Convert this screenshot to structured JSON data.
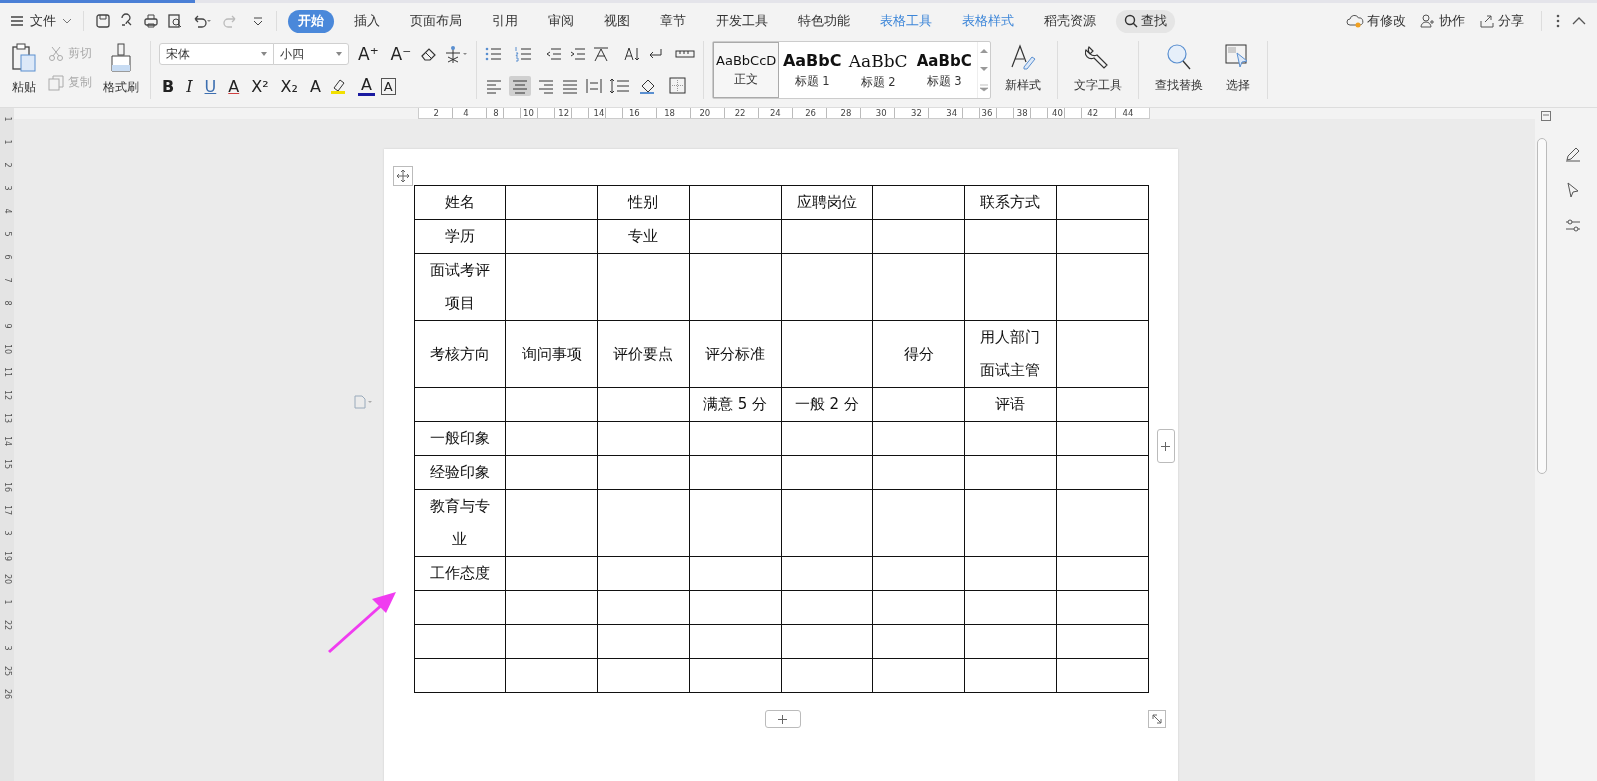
{
  "menu": {
    "file": "文件",
    "tabs": [
      {
        "label": "开始",
        "selected": true,
        "kind": "main"
      },
      {
        "label": "插入",
        "selected": false,
        "kind": "main"
      },
      {
        "label": "页面布局",
        "selected": false,
        "kind": "main"
      },
      {
        "label": "引用",
        "selected": false,
        "kind": "main"
      },
      {
        "label": "审阅",
        "selected": false,
        "kind": "main"
      },
      {
        "label": "视图",
        "selected": false,
        "kind": "main"
      },
      {
        "label": "章节",
        "selected": false,
        "kind": "main"
      },
      {
        "label": "开发工具",
        "selected": false,
        "kind": "main"
      },
      {
        "label": "特色功能",
        "selected": false,
        "kind": "main"
      },
      {
        "label": "表格工具",
        "selected": false,
        "kind": "context"
      },
      {
        "label": "表格样式",
        "selected": false,
        "kind": "context"
      },
      {
        "label": "稻壳资源",
        "selected": false,
        "kind": "main"
      }
    ],
    "search": "查找",
    "right": [
      "有修改",
      "协作",
      "分享"
    ]
  },
  "ribbon": {
    "paste": "粘贴",
    "cut": {
      "label": "剪切",
      "disabled": true
    },
    "copy": {
      "label": "复制",
      "disabled": true
    },
    "format_painter": "格式刷",
    "font_name": "宋体",
    "font_size": "小四",
    "size_buttons": [
      "A⁺",
      "A⁻"
    ],
    "format_buttons": [
      "B",
      "I",
      "U",
      "A",
      "X²",
      "X₂",
      "A"
    ],
    "font_color": "A",
    "char_border": "A",
    "styles": [
      {
        "preview": "AaBbCcD",
        "label": "正文",
        "selected": true,
        "kind": "body"
      },
      {
        "preview": "AaBbC",
        "label": "标题 1",
        "selected": false,
        "kind": "h1"
      },
      {
        "preview": "AaBbC",
        "label": "标题 2",
        "selected": false,
        "kind": "h2"
      },
      {
        "preview": "AaBbC",
        "label": "标题 3",
        "selected": false,
        "kind": "h3"
      }
    ],
    "new_style": "新样式",
    "text_tools": "文字工具",
    "find_replace": "查找替换",
    "select": "选择"
  },
  "ruler": {
    "h_ticks": [
      "2",
      "4",
      "8",
      "10",
      "12",
      "14",
      "16",
      "18",
      "20",
      "22",
      "24",
      "26",
      "28",
      "30",
      "32",
      "34",
      "36",
      "38",
      "40",
      "42",
      "44"
    ],
    "v_ticks": [
      "1",
      "1",
      "2",
      "3",
      "4",
      "5",
      "6",
      "7",
      "8",
      "9",
      "10",
      "11",
      "12",
      "13",
      "14",
      "15",
      "16",
      "17",
      "3",
      "19",
      "20",
      "1",
      "22",
      "3",
      "25",
      "26"
    ]
  },
  "table": {
    "rows": [
      [
        "姓名",
        "",
        "性别",
        "",
        "应聘岗位",
        "",
        "联系方式",
        ""
      ],
      [
        "学历",
        "",
        "专业",
        "",
        "",
        "",
        "",
        ""
      ],
      [
        "面试考评项目",
        "",
        "",
        "",
        "",
        "",
        "",
        ""
      ],
      [
        "考核方向",
        "询问事项",
        "评价要点",
        "评分标准",
        "",
        "得分",
        "用人部门面试主管",
        ""
      ],
      [
        "",
        "",
        "",
        "满意 5 分",
        "一般 2 分",
        "",
        "评语",
        ""
      ],
      [
        "一般印象",
        "",
        "",
        "",
        "",
        "",
        "",
        ""
      ],
      [
        "经验印象",
        "",
        "",
        "",
        "",
        "",
        "",
        ""
      ],
      [
        "教育与专业",
        "",
        "",
        "",
        "",
        "",
        "",
        ""
      ],
      [
        "工作态度",
        "",
        "",
        "",
        "",
        "",
        "",
        ""
      ],
      [
        "",
        "",
        "",
        "",
        "",
        "",
        "",
        ""
      ],
      [
        "",
        "",
        "",
        "",
        "",
        "",
        "",
        ""
      ],
      [
        "",
        "",
        "",
        "",
        "",
        "",
        "",
        ""
      ]
    ]
  }
}
